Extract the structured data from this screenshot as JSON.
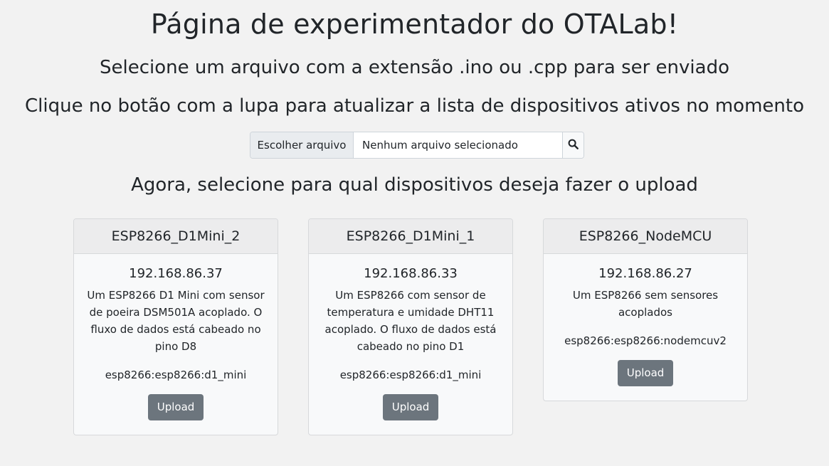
{
  "title": "Página de experimentador do OTALab!",
  "subtitle_1": "Selecione um arquivo com a extensão .ino ou .cpp para ser enviado",
  "subtitle_2": "Clique no botão com a lupa para atualizar a lista de dispositivos ativos no momento",
  "file_input": {
    "choose_label": "Escolher arquivo",
    "selected_text": "Nenhum arquivo selecionado",
    "search_icon": "magnifying-glass-icon"
  },
  "subtitle_3": "Agora, selecione para qual dispositivos deseja fazer o upload",
  "devices": [
    {
      "name": "ESP8266_D1Mini_2",
      "ip": "192.168.86.37",
      "description": "Um ESP8266 D1 Mini com sensor de poeira DSM501A acoplado. O fluxo de dados está cabeado no pino D8",
      "board": "esp8266:esp8266:d1_mini",
      "button_label": "Upload"
    },
    {
      "name": "ESP8266_D1Mini_1",
      "ip": "192.168.86.33",
      "description": "Um ESP8266 com sensor de temperatura e umidade DHT11 acoplado. O fluxo de dados está cabeado no pino D1",
      "board": "esp8266:esp8266:d1_mini",
      "button_label": "Upload"
    },
    {
      "name": "ESP8266_NodeMCU",
      "ip": "192.168.86.27",
      "description": "Um ESP8266 sem sensores acoplados",
      "board": "esp8266:esp8266:nodemcuv2",
      "button_label": "Upload"
    }
  ],
  "colors": {
    "background": "#f2f2f2",
    "button": "#6c757d",
    "card_header": "#ececed"
  }
}
